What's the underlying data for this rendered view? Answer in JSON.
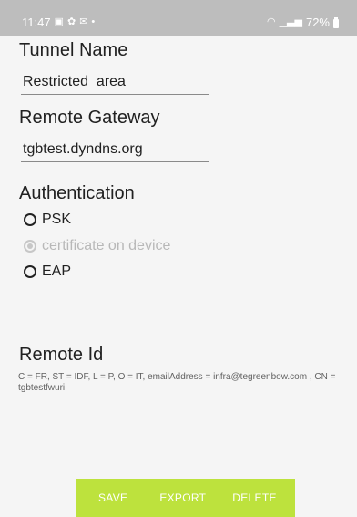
{
  "status_bar": {
    "time": "11:47",
    "notification_icons": [
      "image-icon",
      "gear-icon",
      "mail-icon",
      "dot-icon"
    ],
    "battery_percent": "72%"
  },
  "form": {
    "tunnel_name_label": "Tunnel Name",
    "tunnel_name_value": "Restricted_area",
    "remote_gateway_label": "Remote Gateway",
    "remote_gateway_value": "tgbtest.dyndns.org",
    "authentication_label": "Authentication",
    "auth_options": [
      {
        "label": "PSK",
        "selected": false,
        "enabled": true
      },
      {
        "label": "certificate on device",
        "selected": true,
        "enabled": false
      },
      {
        "label": "EAP",
        "selected": false,
        "enabled": true
      }
    ],
    "remote_id_label": "Remote Id",
    "remote_id_value": "C = FR, ST = IDF, L = P, O = IT, emailAddress = infra@tegreenbow.com , CN = tgbtestfwuri"
  },
  "actions": {
    "save": "SAVE",
    "export": "EXPORT",
    "delete": "DELETE"
  },
  "colors": {
    "status_bar": "#bdbdbd",
    "action_bar": "#bde23d",
    "background": "#f5f5f5"
  }
}
